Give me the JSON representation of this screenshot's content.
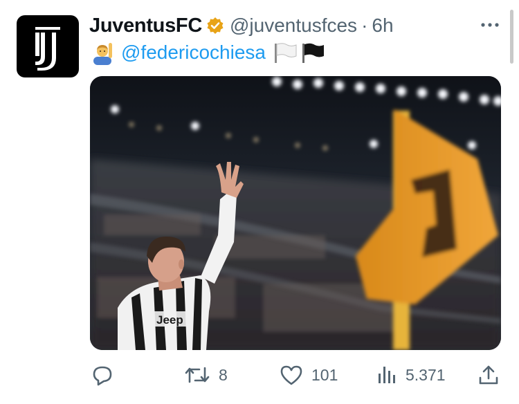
{
  "author": {
    "display_name": "JuventusFC",
    "handle": "@juventusfces",
    "separator": "·",
    "time": "6h",
    "avatar_icon": "juventus-logo-icon",
    "verified_color": "#e8a317"
  },
  "tweet": {
    "emoji_icon": "person-raising-hand-emoji",
    "mention": "@federicochiesa",
    "flags": [
      "white-flag-emoji",
      "black-flag-emoji"
    ]
  },
  "media": {
    "description_icon": "player-waving-photo"
  },
  "actions": {
    "reply": {
      "icon": "reply-icon",
      "count": ""
    },
    "retweet": {
      "icon": "retweet-icon",
      "count": "8"
    },
    "like": {
      "icon": "heart-icon",
      "count": "101"
    },
    "views": {
      "icon": "views-icon",
      "count": "5.371"
    },
    "share": {
      "icon": "share-icon",
      "count": ""
    }
  },
  "colors": {
    "link": "#1d9bf0",
    "text": "#0f1419",
    "muted": "#536471"
  }
}
